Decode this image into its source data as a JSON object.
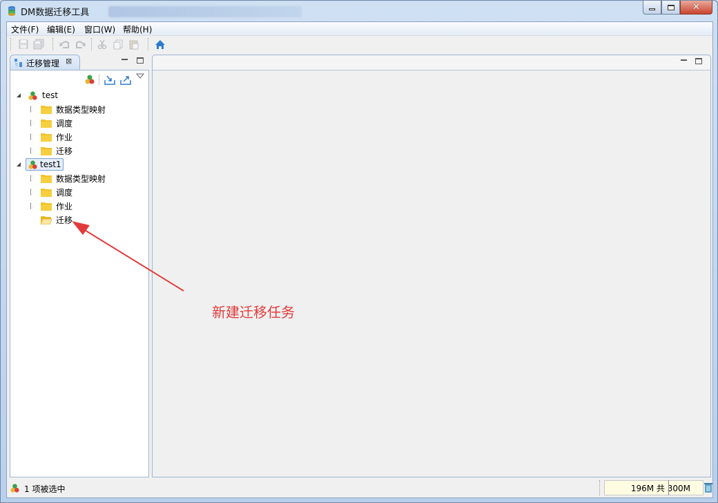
{
  "window": {
    "title": "DM数据迁移工具",
    "close_glyph": "✕"
  },
  "menu": {
    "file": "文件(F)",
    "edit": "编辑(E)",
    "window": "窗口(W)",
    "help": "帮助(H)"
  },
  "toolbar": {
    "icons": [
      "save-icon",
      "save-all-icon",
      "undo-icon",
      "redo-icon",
      "cut-icon",
      "copy-icon",
      "paste-icon",
      "home-icon"
    ]
  },
  "left_view": {
    "tab_label": "迁移管理",
    "close_glyph": "⊠",
    "toolbar_icons": [
      "new-connection-icon",
      "import-icon",
      "export-icon",
      "view-menu-icon"
    ]
  },
  "tree": {
    "connections": [
      {
        "label": "test",
        "expanded": true,
        "children": [
          "数据类型映射",
          "调度",
          "作业",
          "迁移"
        ]
      },
      {
        "label": "test1",
        "expanded": true,
        "selected": true,
        "children": [
          "数据类型映射",
          "调度",
          "作业",
          "迁移"
        ]
      }
    ]
  },
  "annotation": {
    "text": "新建迁移任务",
    "color": "#e23b3b"
  },
  "status": {
    "text": "1 项被选中",
    "heap": "196M 共 300M"
  },
  "colors": {
    "accent_blue": "#2b7bd0",
    "folder": "#f2c22b",
    "arrow_red": "#e23b3b"
  }
}
